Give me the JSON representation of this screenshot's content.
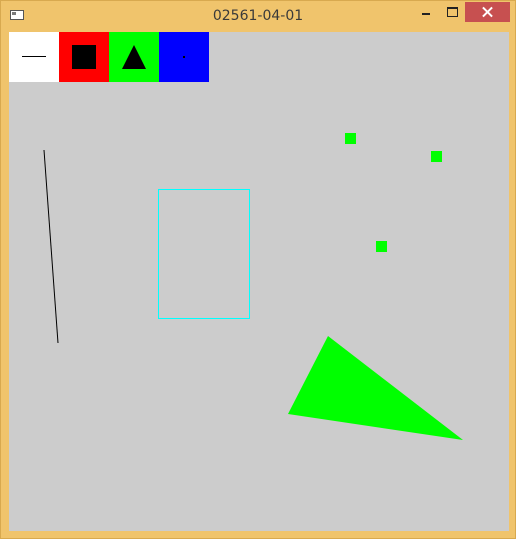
{
  "window": {
    "title": "02561-04-01",
    "icon": "app-window-icon",
    "controls": [
      "minimize-icon",
      "maximize-icon",
      "close-icon"
    ],
    "frame_color": "#f0c46c",
    "close_color": "#c75050"
  },
  "toolbar": {
    "tools": [
      {
        "name": "line",
        "icon": "line-icon",
        "color": "#ffffff"
      },
      {
        "name": "rectangle",
        "icon": "square-icon",
        "color": "#ff0000"
      },
      {
        "name": "triangle",
        "icon": "triangle-icon",
        "color": "#00ff00"
      },
      {
        "name": "point",
        "icon": "point-icon",
        "color": "#0000ff"
      }
    ]
  },
  "canvas": {
    "background": "#cccccc",
    "shapes": [
      {
        "type": "line",
        "color": "#000000"
      },
      {
        "type": "rectangle-outline",
        "color": "#00ffff"
      },
      {
        "type": "point",
        "color": "#00ff00"
      },
      {
        "type": "point",
        "color": "#00ff00"
      },
      {
        "type": "point",
        "color": "#00ff00"
      },
      {
        "type": "triangle",
        "color": "#00ff00"
      }
    ]
  }
}
